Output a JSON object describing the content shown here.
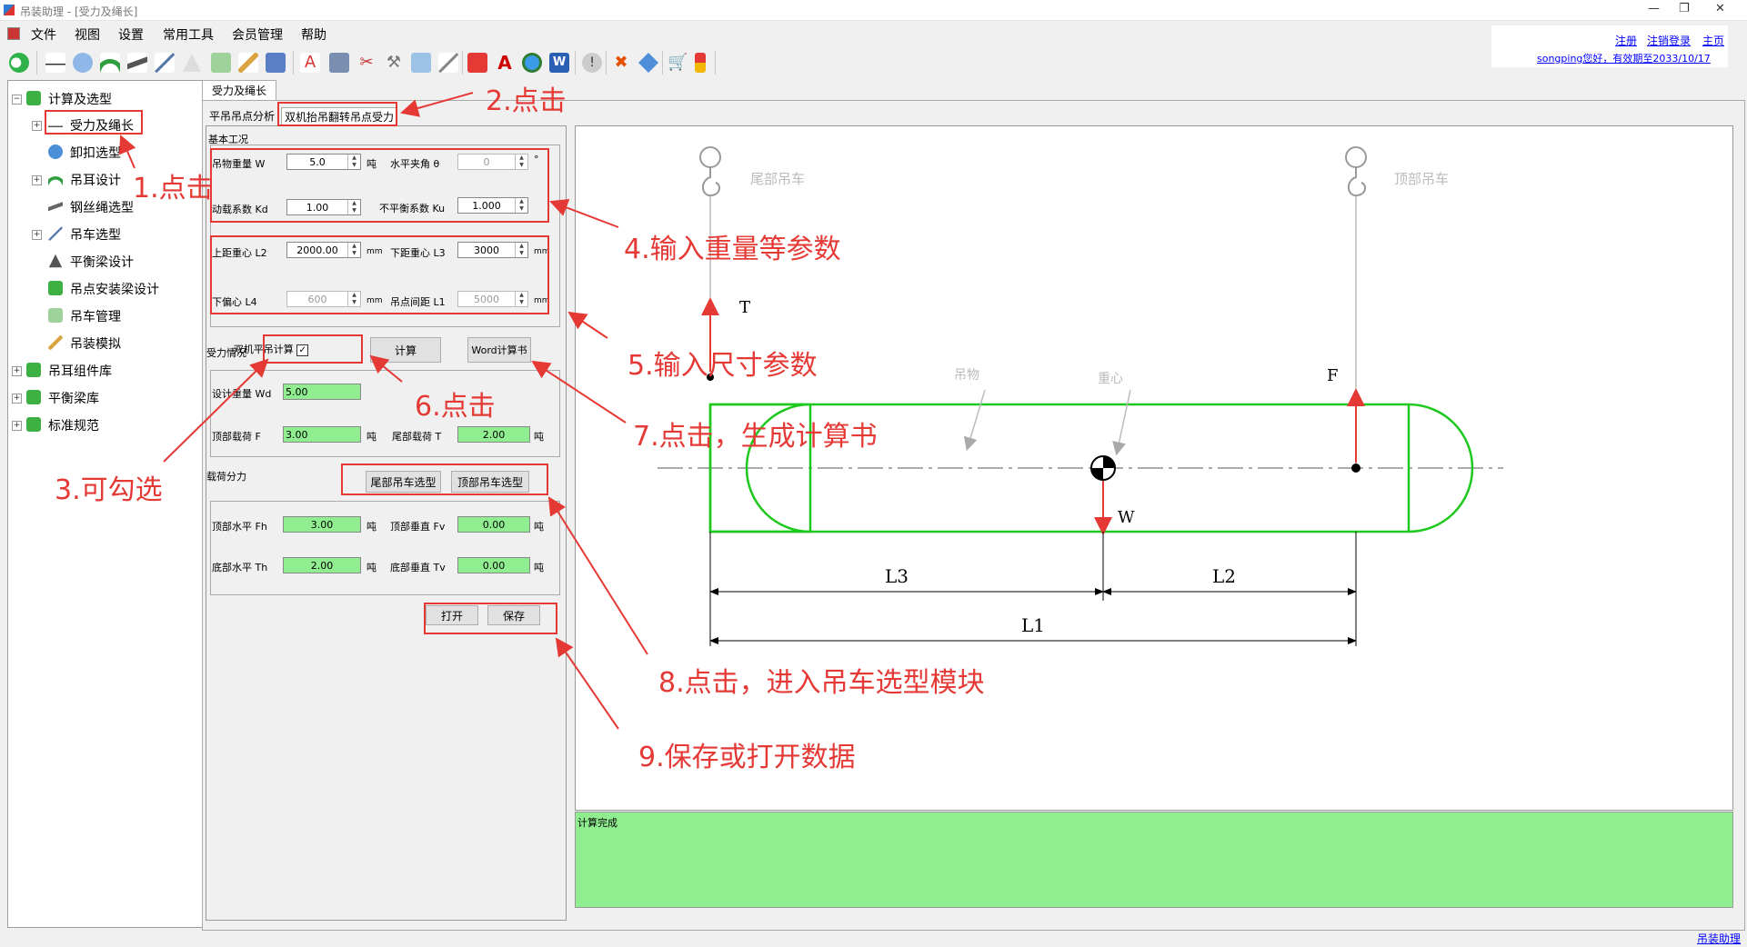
{
  "window": {
    "title": "吊装助理 - [受力及绳长]"
  },
  "menu": [
    "文件",
    "视图",
    "设置",
    "常用工具",
    "会员管理",
    "帮助"
  ],
  "user": {
    "register": "注册",
    "logout": "注销登录",
    "home": "主页",
    "greeting": "songping您好，有效期至2033/10/17"
  },
  "tree": [
    {
      "label": "计算及选型",
      "icon": "puzzle-icon",
      "color": "#3cb043"
    },
    {
      "label": "受力及绳长",
      "icon": "lift-icon",
      "color": "#555"
    },
    {
      "label": "卸扣选型",
      "icon": "shackle-icon",
      "color": "#4a8fd8"
    },
    {
      "label": "吊耳设计",
      "icon": "lug-icon",
      "color": "#2e9e3e"
    },
    {
      "label": "钢丝绳选型",
      "icon": "rope-icon",
      "color": "#666"
    },
    {
      "label": "吊车选型",
      "icon": "crane-icon",
      "color": "#5577aa"
    },
    {
      "label": "平衡梁设计",
      "icon": "triangle-icon",
      "color": "#555"
    },
    {
      "label": "吊点安装梁设计",
      "icon": "puzzle-icon",
      "color": "#3cb043"
    },
    {
      "label": "吊车管理",
      "icon": "truck-crane-icon",
      "color": "#6aa84f"
    },
    {
      "label": "吊装模拟",
      "icon": "simulate-icon",
      "color": "#d9a441"
    },
    {
      "label": "吊耳组件库",
      "icon": "puzzle-icon",
      "color": "#3cb043"
    },
    {
      "label": "平衡梁库",
      "icon": "puzzle-icon",
      "color": "#3cb043"
    },
    {
      "label": "标准规范",
      "icon": "puzzle-icon",
      "color": "#3cb043"
    }
  ],
  "tabs": {
    "main": "受力及绳长",
    "sub1": "平吊吊点分析",
    "sub2": "双机抬吊翻转吊点受力"
  },
  "basic": {
    "group": "基本工况",
    "weight_label": "吊物重量 W",
    "weight_value": "5.0",
    "ton": "吨",
    "angle_label": "水平夹角 θ",
    "angle_value": "0",
    "degree": "°",
    "kd_label": "动载系数 Kd",
    "kd_value": "1.00",
    "ku_label": "不平衡系数 Ku",
    "ku_value": "1.000",
    "l2_label": "上距重心 L2",
    "l2_value": "2000.00",
    "mm": "mm",
    "l3_label": "下距重心 L3",
    "l3_value": "3000",
    "l4_label": "下偏心 L4",
    "l4_value": "600",
    "l1_label": "吊点间距 L1",
    "l1_value": "5000"
  },
  "force": {
    "group": "受力情况",
    "checkbox_label": "双机平吊计算",
    "checkbox_mark": "✓",
    "calc_button": "计算",
    "word_button": "Word计算书",
    "wd_label": "设计重量 Wd",
    "wd_value": "5.00",
    "f_label": "顶部载荷 F",
    "f_value": "3.00",
    "t_label": "尾部载荷 T",
    "t_value": "2.00"
  },
  "split": {
    "group": "载荷分力",
    "tail_crane_button": "尾部吊车选型",
    "top_crane_button": "顶部吊车选型",
    "fh_label": "顶部水平 Fh",
    "fh_value": "3.00",
    "fv_label": "顶部垂直 Fv",
    "fv_value": "0.00",
    "th_label": "底部水平 Th",
    "th_value": "2.00",
    "tv_label": "底部垂直 Tv",
    "tv_value": "0.00"
  },
  "buttons": {
    "open": "打开",
    "save": "保存"
  },
  "diagram": {
    "tail_crane": "尾部吊车",
    "top_crane": "顶部吊车",
    "T": "T",
    "F": "F",
    "W": "W",
    "object": "吊物",
    "cog": "重心",
    "L1": "L1",
    "L2": "L2",
    "L3": "L3"
  },
  "status": "计算完成",
  "footer_link": "吊装助理",
  "notes": {
    "n1": "1.点击",
    "n2": "2.点击",
    "n3": "3.可勾选",
    "n4": "4.输入重量等参数",
    "n5": "5.输入尺寸参数",
    "n6": "6.点击",
    "n7": "7.点击，生成计算书",
    "n8": "8.点击，进入吊车选型模块",
    "n9": "9.保存或打开数据"
  },
  "colors": {
    "annotation": "#e53935",
    "result_bg": "#90ee90",
    "shape": "#1ec81e"
  }
}
